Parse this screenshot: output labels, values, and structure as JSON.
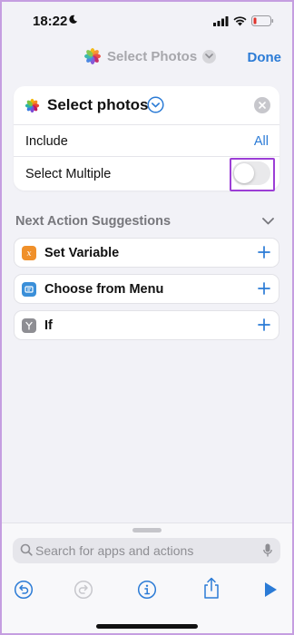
{
  "status_bar": {
    "time": "18:22"
  },
  "nav": {
    "title": "Select Photos",
    "done_label": "Done"
  },
  "action_card": {
    "title": "Select photos",
    "rows": [
      {
        "label": "Include",
        "value": "All"
      },
      {
        "label": "Select Multiple",
        "toggle_on": false
      }
    ]
  },
  "suggestions": {
    "header": "Next Action Suggestions",
    "items": [
      {
        "label": "Set Variable",
        "icon": "variable-icon",
        "color": "#f0902a"
      },
      {
        "label": "Choose from Menu",
        "icon": "menu-icon",
        "color": "#3a8fd9"
      },
      {
        "label": "If",
        "icon": "branch-icon",
        "color": "#8e8e93"
      }
    ]
  },
  "search": {
    "placeholder": "Search for apps and actions",
    "value": ""
  },
  "toolbar": {
    "icons": [
      "undo-icon",
      "redo-icon",
      "info-icon",
      "share-icon",
      "play-icon"
    ]
  },
  "colors": {
    "accent": "#2b7bd6",
    "highlight": "#9c3fd6",
    "background": "#f2f2f7"
  }
}
